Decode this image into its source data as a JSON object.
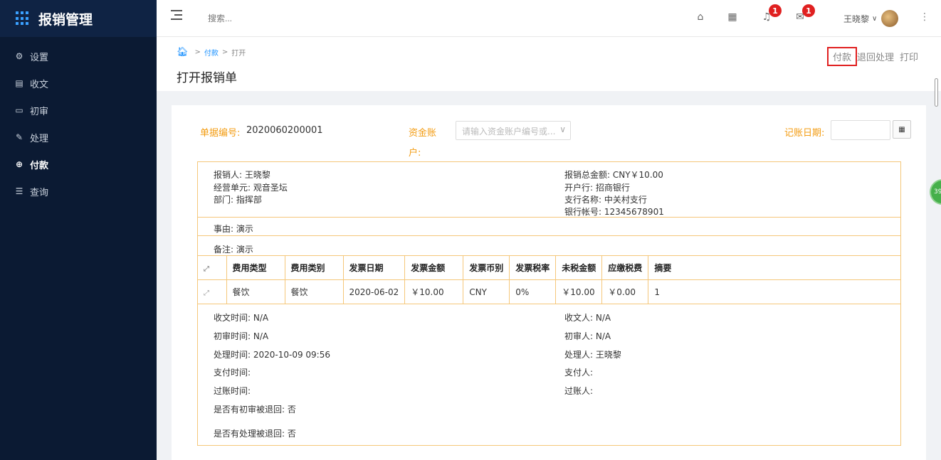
{
  "app": {
    "title": "报销管理"
  },
  "sidebar": {
    "items": [
      {
        "label": "设置",
        "icon": "gear-icon"
      },
      {
        "label": "收文",
        "icon": "document-icon"
      },
      {
        "label": "初审",
        "icon": "form-icon"
      },
      {
        "label": "处理",
        "icon": "edit-icon"
      },
      {
        "label": "付款",
        "icon": "search-coin-icon",
        "active": true
      },
      {
        "label": "查询",
        "icon": "list-icon"
      }
    ]
  },
  "header": {
    "search_placeholder": "搜索...",
    "notifications_badge": "1",
    "messages_badge": "1",
    "user_name": "王晓黎"
  },
  "breadcrumb": {
    "items": [
      "付款",
      "打开"
    ]
  },
  "page": {
    "title": "打开报销单"
  },
  "actions": {
    "pay": "付款",
    "return": "退回处理",
    "print": "打印"
  },
  "form": {
    "doc_no_label": "单据编号:",
    "doc_no_value": "2020060200001",
    "account_label_1": "资金账",
    "account_label_2": "户:",
    "account_placeholder": "请输入资金账户编号或...",
    "date_label": "记账日期:"
  },
  "summary": {
    "reporter": "报销人:  王晓黎",
    "unit": "经营单元:  观音圣坛",
    "dept": "部门:  指挥部",
    "total": "报销总金额:  CNY￥10.00",
    "bank": "开户行:  招商银行",
    "branch": "支行名称:  中关村支行",
    "account": "银行帐号:  12345678901",
    "reason": "事由:  演示",
    "remark": "备注:  演示"
  },
  "table": {
    "headers": [
      "费用类型",
      "费用类别",
      "发票日期",
      "发票金额",
      "发票币别",
      "发票税率",
      "未税金额",
      "应缴税费",
      "摘要"
    ],
    "rows": [
      [
        "餐饮",
        "餐饮",
        "2020-06-02",
        "￥10.00",
        "CNY",
        "0%",
        "￥10.00",
        "￥0.00",
        "1"
      ]
    ]
  },
  "meta": {
    "receive_time": "收文时间:  N/A",
    "receive_by": "收文人:  N/A",
    "review_time": "初审时间:  N/A",
    "review_by": "初审人:  N/A",
    "process_time": "处理时间:  2020-10-09 09:56",
    "process_by": "处理人:  王晓黎",
    "pay_time": "支付时间:",
    "pay_by": "支付人:",
    "post_time": "过账时间:",
    "post_by": "过账人:",
    "review_returned": "是否有初审被退回:  否",
    "process_returned": "是否有处理被退回:  否"
  },
  "float_badge": "39"
}
